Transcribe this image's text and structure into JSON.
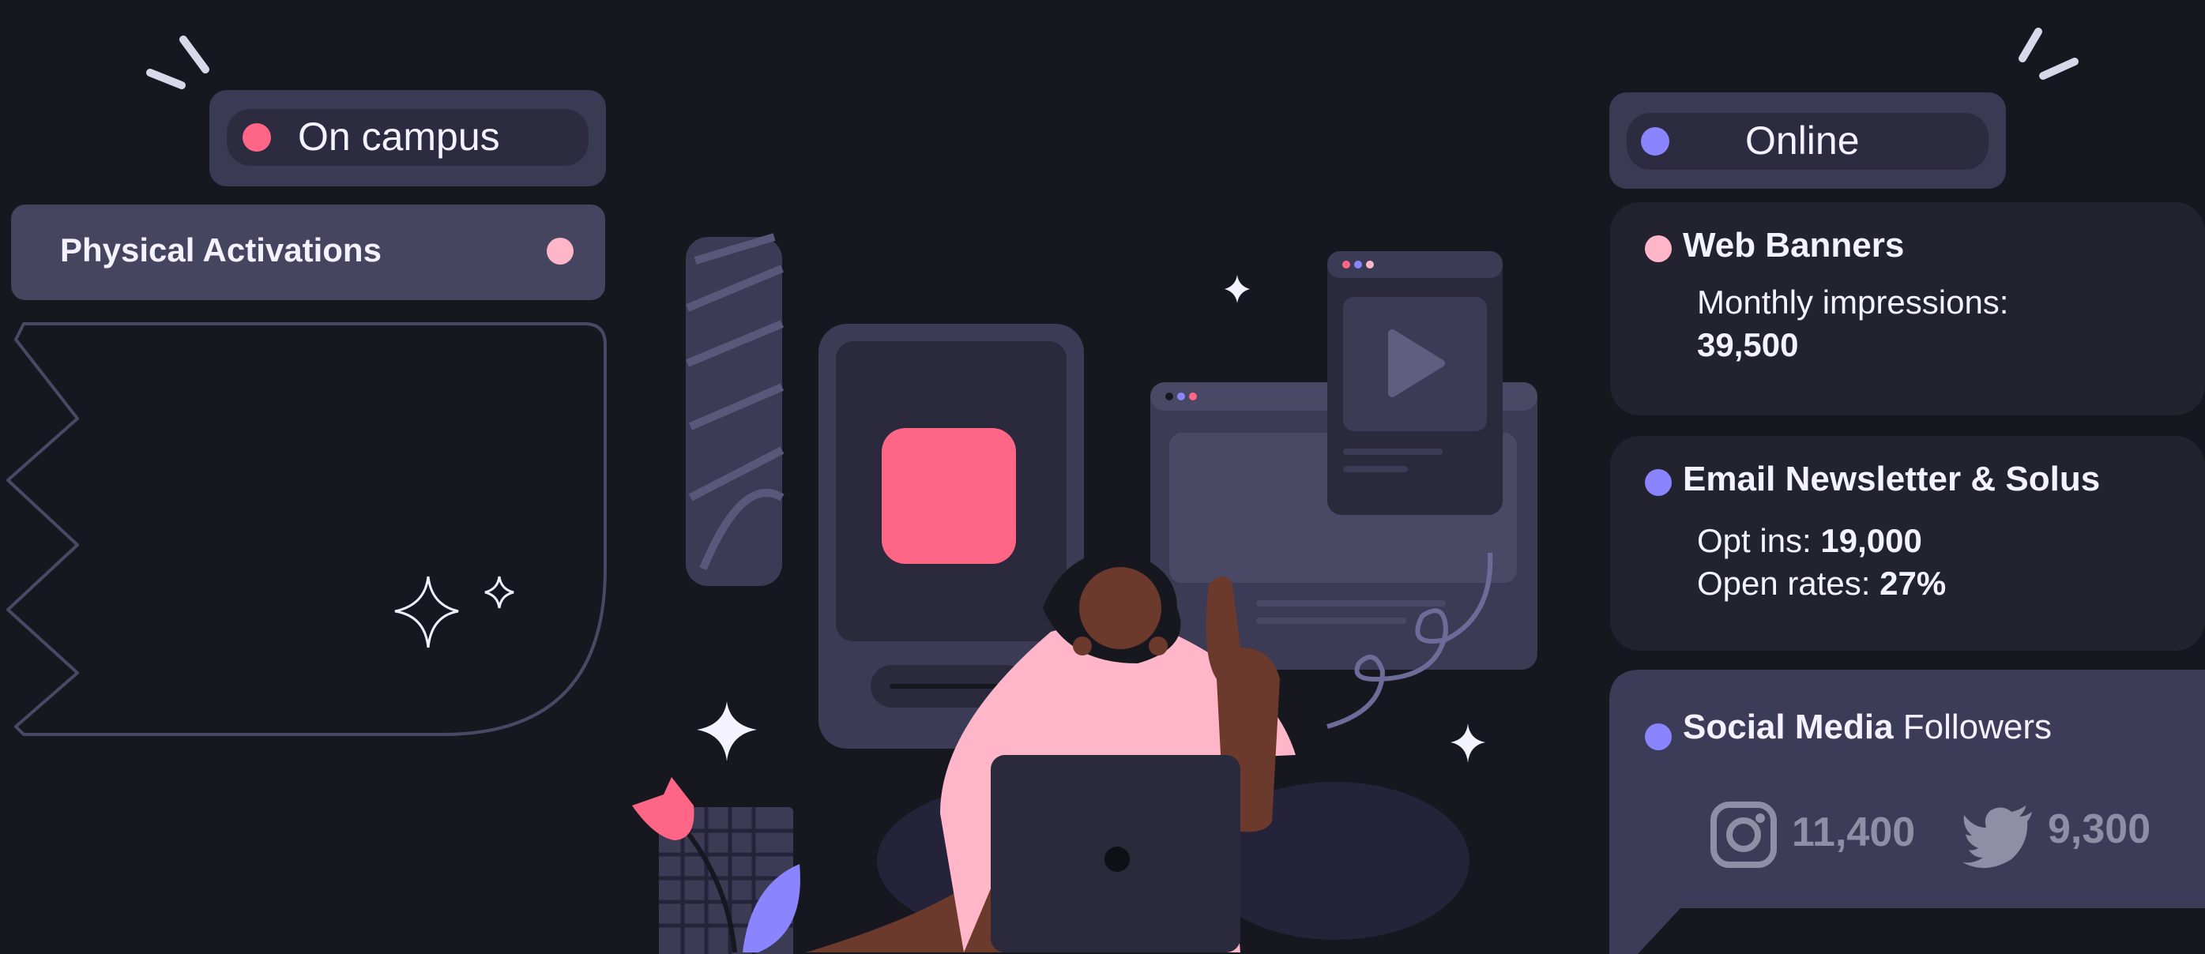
{
  "left": {
    "tag": {
      "label": "On campus",
      "dot_color": "#ff6584"
    },
    "bar": {
      "label": "Physical Activations",
      "dot_color": "#ffb6c8"
    }
  },
  "right": {
    "tag": {
      "label": "Online",
      "dot_color": "#8b84ff"
    },
    "web_banners": {
      "title": "Web Banners",
      "dot_color": "#ffb6c8",
      "impressions_label": "Monthly impressions:",
      "impressions_value": "39,500"
    },
    "email": {
      "title": "Email Newsletter & Solus",
      "dot_color": "#8b84ff",
      "opt_ins_label": "Opt ins:",
      "opt_ins_value": "19,000",
      "open_rates_label": "Open rates:",
      "open_rates_value": "27%"
    },
    "social": {
      "title_bold": "Social Media",
      "title_regular": "Followers",
      "dot_color": "#8b84ff",
      "instagram_count": "11,400",
      "twitter_count": "9,300",
      "instagram_icon": "instagram-icon",
      "twitter_icon": "twitter-icon"
    }
  },
  "colors": {
    "background": "#17171f",
    "panel": "#3b3a55",
    "card_dark": "#23222f",
    "card_light": "#3d3c58",
    "accent_pink": "#ff6584",
    "accent_purple": "#8b84ff"
  }
}
